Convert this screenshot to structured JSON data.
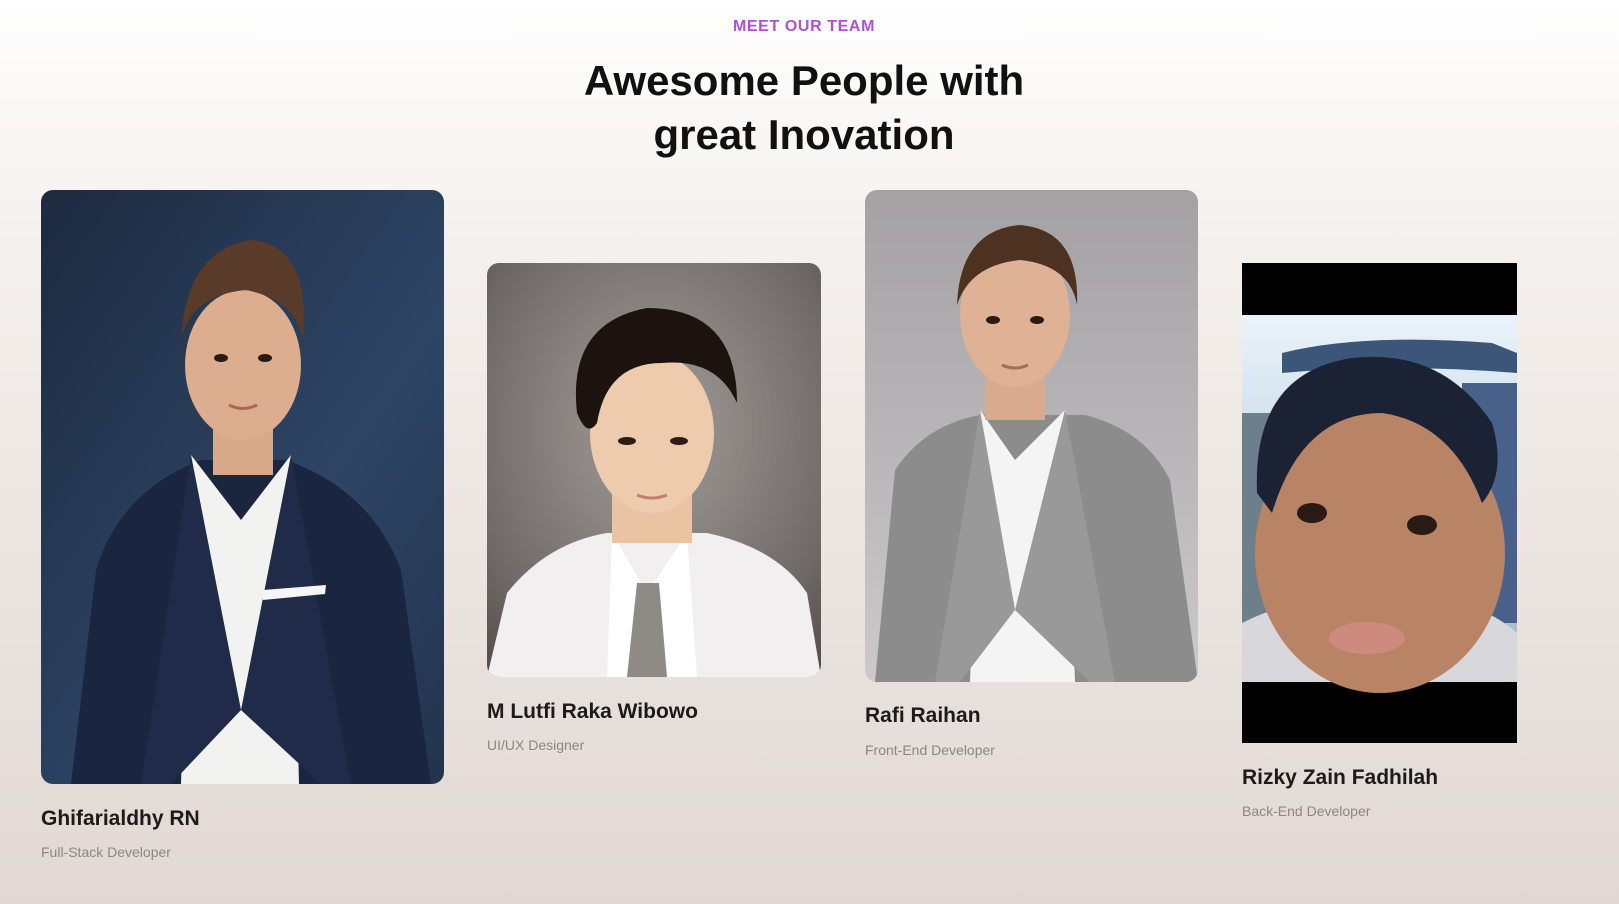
{
  "section": {
    "eyebrow": "MEET OUR TEAM",
    "title_line1": "Awesome People with",
    "title_line2": "great Inovation"
  },
  "team": [
    {
      "name": "Ghifarialdhy RN",
      "role": "Full-Stack Developer"
    },
    {
      "name": "M Lutfi Raka Wibowo",
      "role": "UI/UX Designer"
    },
    {
      "name": "Rafi Raihan",
      "role": "Front-End Developer"
    },
    {
      "name": "Rizky Zain Fadhilah",
      "role": "Back-End Developer"
    }
  ],
  "colors": {
    "accent": "#b14fd8",
    "heading": "#111111",
    "role_text": "#8b8684"
  }
}
